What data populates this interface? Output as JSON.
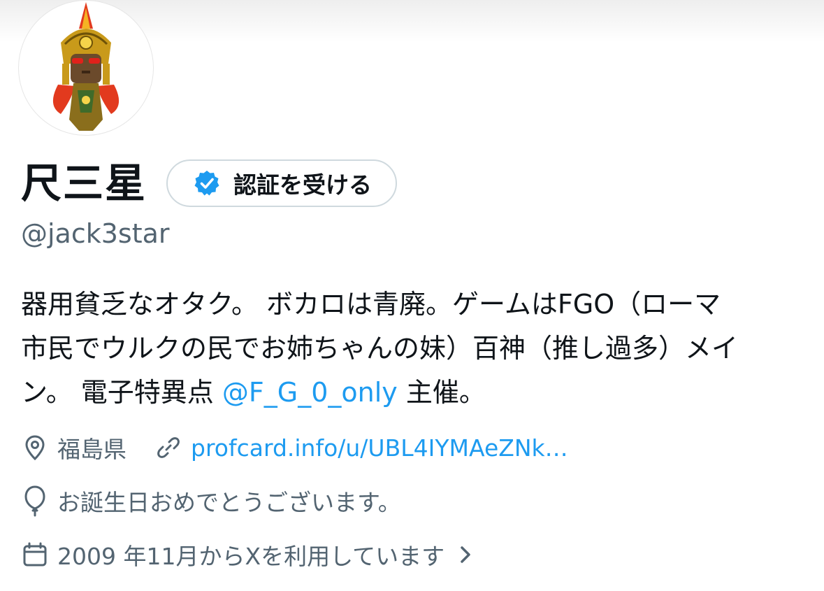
{
  "profile": {
    "display_name": "尺三星",
    "verify_button_label": "認証を受ける",
    "handle": "@jack3star"
  },
  "bio": {
    "line1": "器用貧乏なオタク。 ボカロは青廃。ゲームはFGO（ローマ",
    "line2": "市民でウルクの民でお姉ちゃんの妹）百神（推し過多）メイ",
    "line3_prefix": "ン。 電子特異点 ",
    "line3_mention": "@F_G_0_only",
    "line3_suffix": " 主催。"
  },
  "meta": {
    "location": "福島県",
    "link": "profcard.info/u/UBL4IYMAeZNk…",
    "birthday": "お誕生日おめでとうございます。",
    "joined": "2009 年11月からXを利用しています"
  },
  "icons": {
    "location": "location-pin-icon",
    "link": "link-icon",
    "birthday": "balloon-icon",
    "joined": "calendar-icon",
    "verify": "verified-badge-icon",
    "more": "chevron-right-icon"
  },
  "colors": {
    "accent": "#1d9bf0",
    "secondary_text": "#536471",
    "primary_text": "#0f1419",
    "border": "#cfd9de"
  }
}
